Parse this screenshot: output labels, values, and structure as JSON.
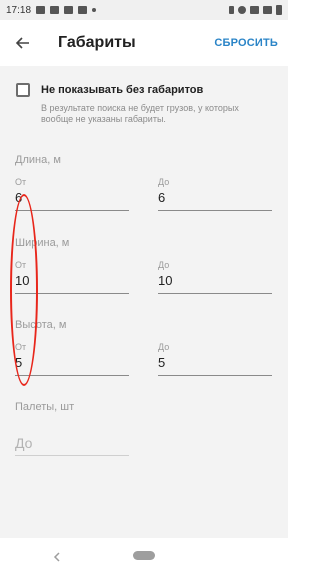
{
  "status_bar": {
    "time": "17:18"
  },
  "app_bar": {
    "title": "Габариты",
    "reset_label": "СБРОСИТЬ"
  },
  "no_dimensions": {
    "label": "Не показывать без габаритов",
    "hint": "В результате поиска не будет грузов, у которых вообще не указаны габариты.",
    "checked": false
  },
  "length": {
    "label": "Длина, м",
    "from_label": "От",
    "from_value": "6",
    "to_label": "До",
    "to_value": "6"
  },
  "width": {
    "label": "Ширина, м",
    "from_label": "От",
    "from_value": "10",
    "to_label": "До",
    "to_value": "10"
  },
  "height": {
    "label": "Высота, м",
    "from_label": "От",
    "from_value": "5",
    "to_label": "До",
    "to_value": "5"
  },
  "pallets": {
    "label": "Палеты, шт",
    "to_placeholder": "До"
  },
  "colors": {
    "accent": "#2a84c7",
    "annotation": "#e8261b",
    "background": "#f3f3f3"
  },
  "icons": [
    "back-arrow-icon",
    "checkbox-icon",
    "nav-back-icon",
    "nav-home-icon"
  ]
}
